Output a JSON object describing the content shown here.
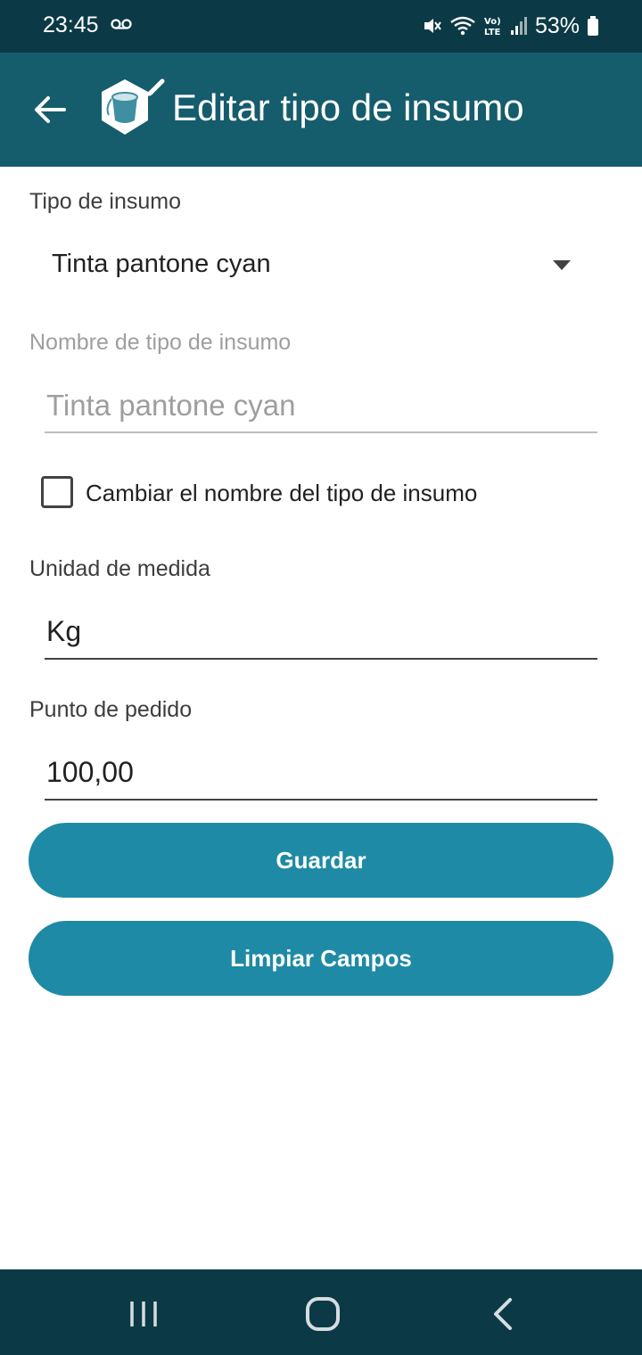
{
  "status_bar": {
    "time": "23:45",
    "voicemail_icon": "voicemail-icon",
    "battery_percent": "53%",
    "icons": [
      "vibrate-mute-icon",
      "wifi-icon",
      "volte-icon",
      "signal-icon",
      "battery-icon"
    ]
  },
  "app_bar": {
    "title": "Editar tipo de insumo",
    "back_icon": "arrow-back-icon",
    "logo_icon": "paint-bucket-edit-icon"
  },
  "form": {
    "tipo_label": "Tipo de insumo",
    "tipo_selected": "Tinta pantone cyan",
    "nombre_label": "Nombre de tipo de insumo",
    "nombre_value": "Tinta pantone cyan",
    "cambiar_checkbox_label": "Cambiar el nombre del tipo de insumo",
    "cambiar_checked": false,
    "unidad_label": "Unidad de medida",
    "unidad_value": "Kg",
    "punto_label": "Punto de pedido",
    "punto_value": "100,00"
  },
  "buttons": {
    "guardar": "Guardar",
    "limpiar": "Limpiar Campos"
  },
  "colors": {
    "status_bar": "#0b3a46",
    "app_bar": "#155c6c",
    "button": "#1e8aa6"
  },
  "nav_bar": {
    "icons": [
      "recent-apps-icon",
      "home-icon",
      "back-icon"
    ]
  }
}
